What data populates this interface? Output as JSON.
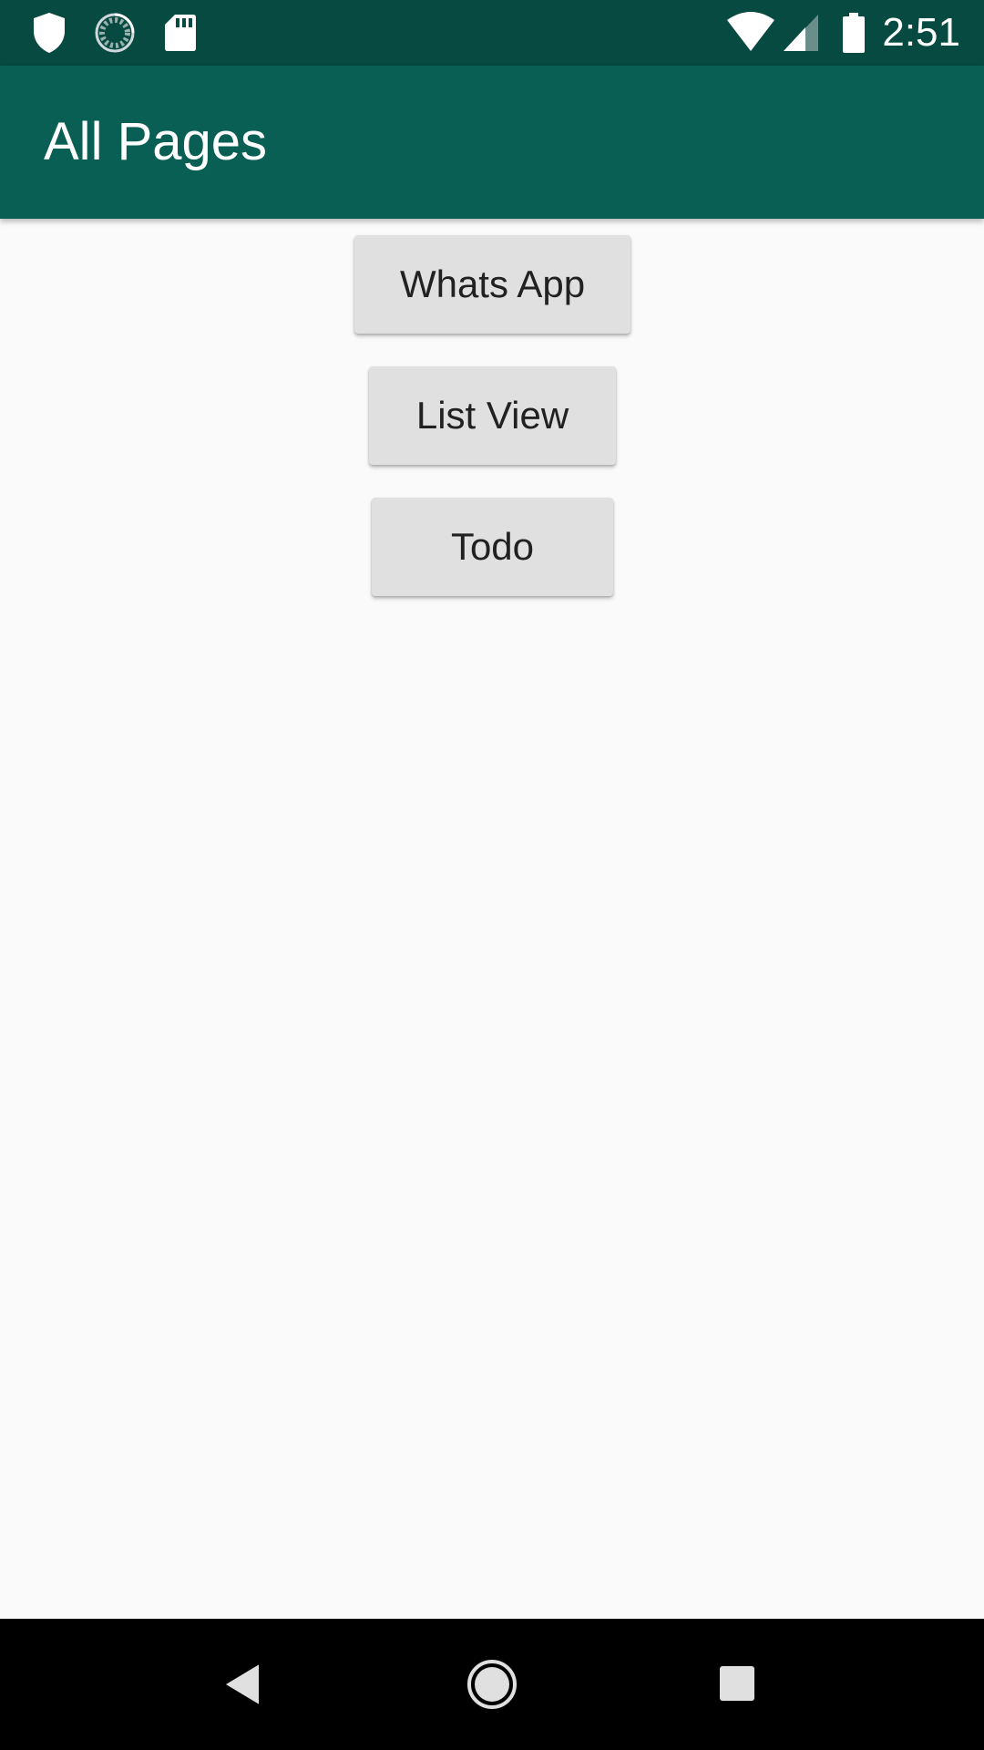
{
  "status_bar": {
    "time": "2:51",
    "left_icons": [
      "shield-icon",
      "sync-icon",
      "sd-card-icon"
    ],
    "right_icons": [
      "wifi-icon",
      "cell-signal-icon",
      "battery-icon"
    ]
  },
  "app_bar": {
    "title": "All Pages"
  },
  "buttons": {
    "whatsapp": "Whats App",
    "listview": "List View",
    "todo": "Todo"
  },
  "nav_bar": {
    "icons": [
      "back-icon",
      "home-icon",
      "recents-icon"
    ]
  },
  "colors": {
    "status_bar": "#064a41",
    "app_bar": "#0a5f55",
    "background": "#fafafa",
    "button": "#e0e0e0",
    "button_text": "#212121"
  }
}
